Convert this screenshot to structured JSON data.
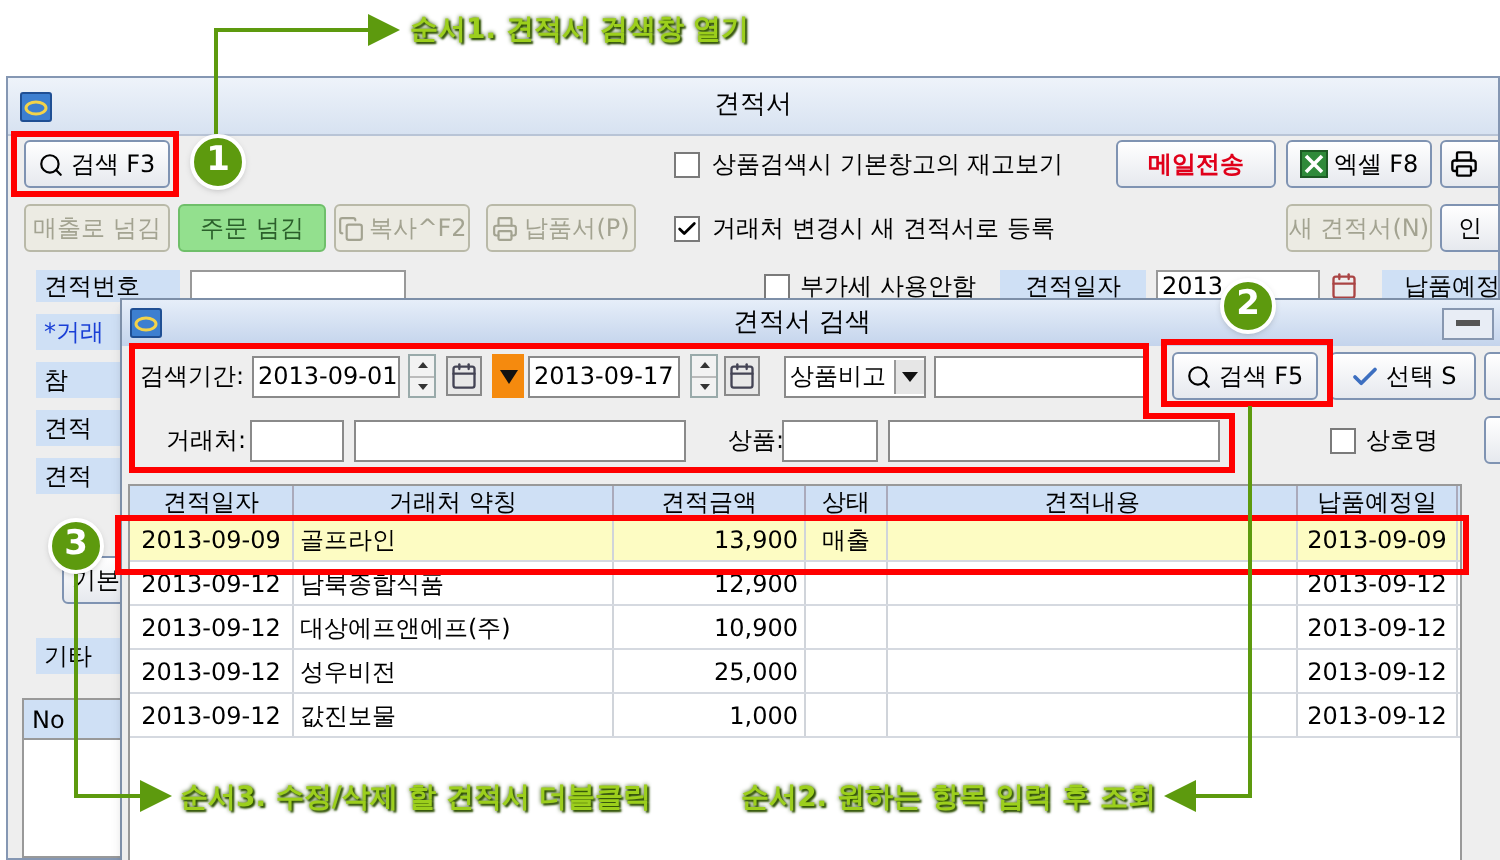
{
  "annotations": [
    {
      "badge": "1",
      "label": "순서1. 견적서 검색창 열기"
    },
    {
      "badge": "3",
      "label": "순서3. 수정/삭제 할 견적서 더블클릭"
    },
    {
      "badge": "2",
      "label": "순서2. 원하는 항목 입력 후 조회"
    }
  ],
  "window": {
    "title": "견적서"
  },
  "toolbar": {
    "search_button": "검색 F3",
    "stock_option": {
      "label": "상품검색시 기본창고의 재고보기",
      "checked": false
    },
    "mail_button": "메일전송",
    "excel_button": "엑셀 F8"
  },
  "actions": [
    {
      "kind": "text",
      "label": "매출로 넘김",
      "disabled": true
    },
    {
      "kind": "text",
      "label": "주문 넘김",
      "disabled": false
    },
    {
      "kind": "copy",
      "label": "복사^F2",
      "disabled": true
    },
    {
      "kind": "print",
      "label": "납품서(P)",
      "disabled": true
    }
  ],
  "new_partner_option": {
    "label": "거래처 변경시 새 견적서로 등록",
    "checked": true
  },
  "new_button": {
    "label": "새 견적서(N)",
    "disabled": true
  },
  "cut_button": "인",
  "form": {
    "number_label": "견적번호",
    "vat_option": {
      "label": "부가세 사용안함",
      "checked": false
    },
    "date_label": "견적일자",
    "date_value": "2013",
    "due_label": "납품예정",
    "side_labels": [
      {
        "label": "*거래",
        "required": true
      },
      {
        "label": "참",
        "required": false
      },
      {
        "label": "견적",
        "required": false
      },
      {
        "label": "견적",
        "required": false
      }
    ],
    "basic_button": "기본",
    "etc_label": "기타",
    "list_header": "No"
  },
  "dialog": {
    "title": "견적서 검색",
    "period_label": "검색기간:",
    "date_from": "2013-09-01",
    "date_to": "2013-09-17",
    "filter_select": "상품비고",
    "search_button": "검색 F5",
    "select_button": "선택 S",
    "partner_label": "거래처:",
    "product_label": "상품:",
    "trade_name_option": {
      "label": "상호명",
      "checked": false
    }
  },
  "table": {
    "columns": [
      "견적일자",
      "거래처 약칭",
      "견적금액",
      "상태",
      "견적내용",
      "납품예정일"
    ],
    "rows": [
      {
        "date": "2013-09-09",
        "partner": "골프라인",
        "amount": "13,900",
        "status": "매출",
        "due": "2013-09-09",
        "selected": true
      },
      {
        "date": "2013-09-12",
        "partner": "남북종합식품",
        "amount": "12,900",
        "due": "2013-09-12",
        "selected": false
      },
      {
        "date": "2013-09-12",
        "partner": "대상에프앤에프(주)",
        "amount": "10,900",
        "due": "2013-09-12",
        "selected": false
      },
      {
        "date": "2013-09-12",
        "partner": "성우비전",
        "amount": "25,000",
        "due": "2013-09-12",
        "selected": false
      },
      {
        "date": "2013-09-12",
        "partner": "값진보물",
        "amount": "1,000",
        "due": "2013-09-12",
        "selected": false
      }
    ]
  }
}
